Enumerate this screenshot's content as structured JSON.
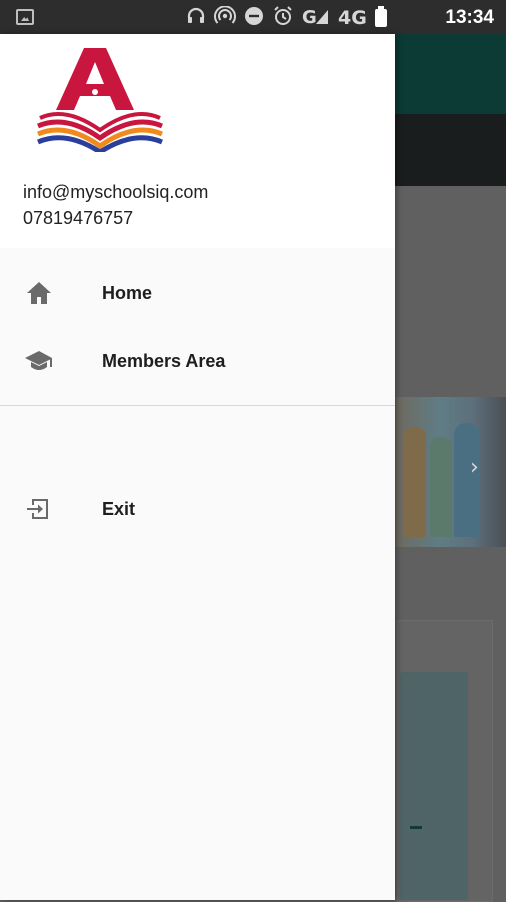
{
  "status_bar": {
    "time": "13:34",
    "network": "4G",
    "icons": [
      "image-icon",
      "headset-icon",
      "hotspot-icon",
      "do-not-disturb-icon",
      "alarm-icon",
      "signal-icon",
      "battery-icon"
    ]
  },
  "drawer": {
    "brand_logo": "A",
    "email": "info@myschoolsiq.com",
    "phone": "07819476757",
    "items": [
      {
        "label": "Home",
        "icon": "home-icon"
      },
      {
        "label": "Members Area",
        "icon": "graduation-cap-icon"
      },
      {
        "label": "Exit",
        "icon": "exit-icon"
      }
    ]
  },
  "colors": {
    "toolbar": "#0b3b34",
    "logo_red": "#c8163f",
    "logo_orange": "#f08a1c",
    "logo_blue": "#2a3f9b"
  }
}
